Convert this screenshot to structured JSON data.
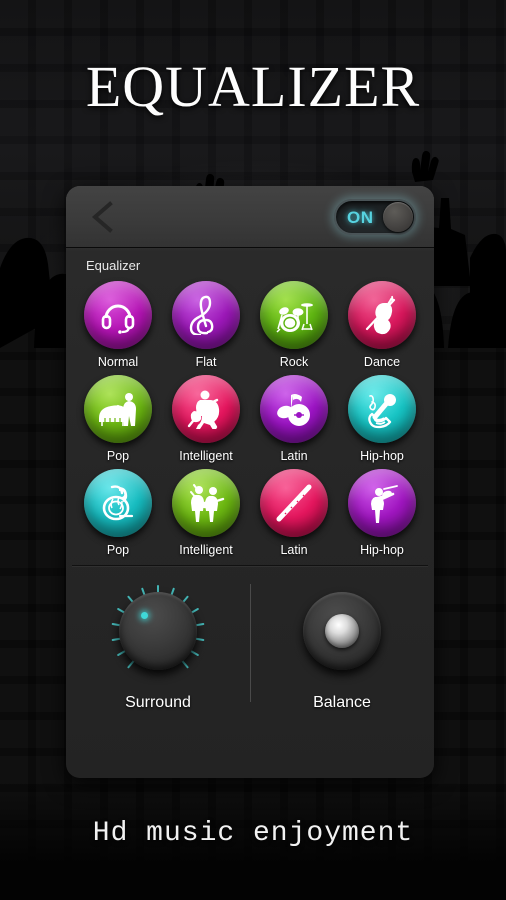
{
  "app": {
    "title": "EQUALIZER",
    "tagline": "Hd music enjoyment"
  },
  "header": {
    "back_icon": "back-chevron-icon",
    "power_toggle": {
      "label": "ON",
      "state": "on",
      "glow_color": "#57d3e0"
    }
  },
  "equalizer": {
    "section_label": "Equalizer",
    "presets": [
      {
        "label": "Normal",
        "icon": "headphones-icon",
        "color": "#b514b5"
      },
      {
        "label": "Flat",
        "icon": "treble-clef-icon",
        "color": "#9c18b8"
      },
      {
        "label": "Rock",
        "icon": "drum-kit-icon",
        "color": "#5fb512"
      },
      {
        "label": "Dance",
        "icon": "violin-icon",
        "color": "#d8175c"
      },
      {
        "label": "Pop",
        "icon": "piano-singer-icon",
        "color": "#6db812"
      },
      {
        "label": "Intelligent",
        "icon": "guitarist-icon",
        "color": "#e51croun"
      },
      {
        "label": "Latin",
        "icon": "note-disc-icon",
        "color": "#9c14c4"
      },
      {
        "label": "Hip-hop",
        "icon": "microphone-icon",
        "color": "#17c4c4"
      },
      {
        "label": "Pop",
        "icon": "french-horn-icon",
        "color": "#17bcc0"
      },
      {
        "label": "Intelligent",
        "icon": "band-icon",
        "color": "#6db812"
      },
      {
        "label": "Latin",
        "icon": "flute-icon",
        "color": "#e5165e"
      },
      {
        "label": "Hip-hop",
        "icon": "violinist-icon",
        "color": "#a016c0"
      }
    ]
  },
  "controls": {
    "surround": {
      "label": "Surround",
      "type": "rotary-knob",
      "indicator_color": "#3fd8d8"
    },
    "balance": {
      "label": "Balance",
      "type": "rotary-knob"
    }
  }
}
